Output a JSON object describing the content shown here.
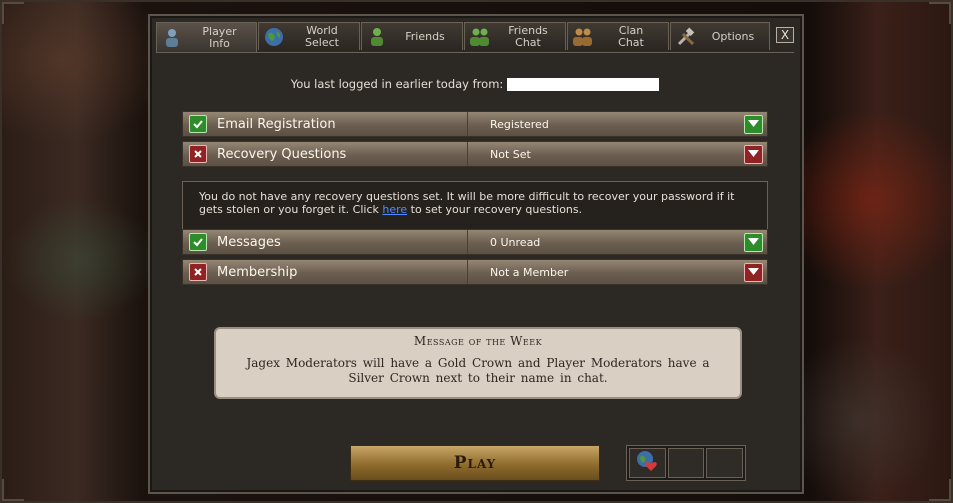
{
  "tabs": [
    {
      "label": "Player\nInfo",
      "icon": "player-icon"
    },
    {
      "label": "World\nSelect",
      "icon": "globe-icon"
    },
    {
      "label": "Friends",
      "icon": "friend-icon"
    },
    {
      "label": "Friends\nChat",
      "icon": "friends-chat-icon"
    },
    {
      "label": "Clan\nChat",
      "icon": "clan-icon"
    },
    {
      "label": "Options",
      "icon": "tools-icon"
    }
  ],
  "close_label": "X",
  "last_login": "You last logged in earlier today from:",
  "rows": [
    {
      "label": "Email Registration",
      "value": "Registered",
      "status": "ok"
    },
    {
      "label": "Recovery Questions",
      "value": "Not Set",
      "status": "bad"
    },
    {
      "label": "Messages",
      "value": "0 Unread",
      "status": "ok"
    },
    {
      "label": "Membership",
      "value": "Not a Member",
      "status": "bad"
    }
  ],
  "notice": {
    "text_before": "You do not have any recovery questions set. It will be more difficult to recover your password if it gets stolen or you forget it. Click ",
    "link": "here",
    "text_after": " to set your recovery questions."
  },
  "motw": {
    "title": "Message of the Week",
    "body": "Jagex Moderators will have a Gold Crown and Player Moderators have a Silver Crown next to their name in chat."
  },
  "play_label": "Play",
  "colors": {
    "ok": "#2e8d2a",
    "bad": "#8f2222",
    "link": "#4f8cff"
  }
}
